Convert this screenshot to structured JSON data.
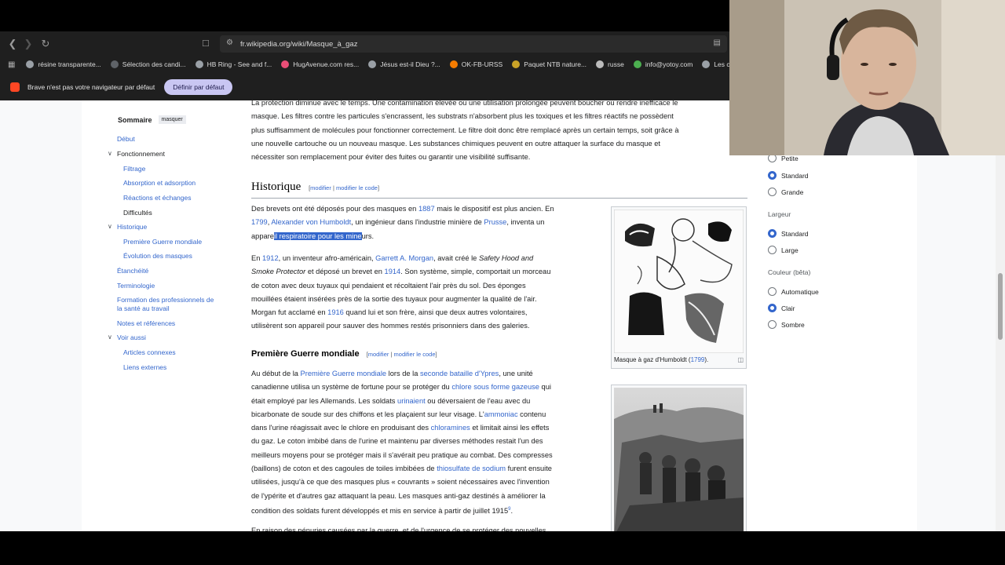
{
  "browser": {
    "url": "fr.wikipedia.org/wiki/Masque_à_gaz",
    "bookmarks": [
      {
        "label": "résine transparente...",
        "color": "#9aa0a6"
      },
      {
        "label": "Sélection des candi...",
        "color": "#5f6368"
      },
      {
        "label": "HB Ring - See and f...",
        "color": "#9aa0a6"
      },
      {
        "label": "HugAvenue.com res...",
        "color": "#e94e77"
      },
      {
        "label": "Jésus est-il Dieu ?...",
        "color": "#9aa0a6"
      },
      {
        "label": "OK-FB-URSS",
        "color": "#f57c00"
      },
      {
        "label": "Paquet NTB nature...",
        "color": "#c9a227"
      },
      {
        "label": "russe",
        "color": "#bbbbbb"
      },
      {
        "label": "info@yotoy.com",
        "color": "#4caf50"
      },
      {
        "label": "Les concours d'a",
        "color": "#9aa0a6"
      }
    ],
    "infobar": {
      "text": "Brave n'est pas votre navigateur par défaut",
      "button": "Définir par défaut"
    },
    "nav_icons": [
      "back-icon",
      "forward-icon",
      "reload-icon"
    ]
  },
  "toc": {
    "title": "Sommaire",
    "hide": "masquer",
    "items": [
      {
        "label": "Début"
      },
      {
        "label": "Fonctionnement"
      },
      {
        "label": "Filtrage"
      },
      {
        "label": "Absorption et adsorption"
      },
      {
        "label": "Réactions et échanges"
      },
      {
        "label": "Difficultés"
      },
      {
        "label": "Historique"
      },
      {
        "label": "Première Guerre mondiale"
      },
      {
        "label": "Évolution des masques"
      },
      {
        "label": "Étanchéité"
      },
      {
        "label": "Terminologie"
      },
      {
        "label": "Formation des professionnels de"
      },
      {
        "label": "la santé au travail"
      },
      {
        "label": "Notes et références"
      },
      {
        "label": "Voir aussi"
      },
      {
        "label": "Articles connexes"
      },
      {
        "label": "Liens externes"
      }
    ]
  },
  "article": {
    "intro_lines": [
      "La protection diminue avec le temps. Une contamination élevée ou une utilisation prolongée peuvent boucher ou rendre inefficace le",
      "masque. Les filtres contre les particules s'encrassent, les substrats n'absorbent plus les toxiques et les filtres réactifs ne possèdent",
      "plus suffisamment de molécules pour fonctionner correctement. Le filtre doit donc être remplacé après un certain temps, soit grâce à",
      "une nouvelle cartouche ou un nouveau masque. Les substances chimiques peuvent en outre attaquer la surface du masque et",
      "nécessiter son remplacement pour éviter des fuites ou garantir une visibilité suffisante."
    ],
    "historique": {
      "title": "Historique",
      "edit": "modifier",
      "edit_code": "modifier le code",
      "sep": "|",
      "open": "[",
      "close": "]",
      "p1": {
        "l1a": "Des brevets ont été déposés pour des masques en ",
        "l1link": "1887",
        "l1b": " mais le dispositif est plus ancien. En",
        "l2link1": "1799",
        "l2a": ", ",
        "l2link2": "Alexander von Humboldt",
        "l2b": ", un ingénieur dans l'industrie minière de ",
        "l2link3": "Prusse",
        "l2c": ", inventa un",
        "l3a": "appare",
        "l3sel": "il respiratoire pour les mine",
        "l3b": "urs."
      },
      "p2": {
        "l1a": "En ",
        "l1link1": "1912",
        "l1b": ", un inventeur afro-américain, ",
        "l1link2": "Garrett A. Morgan",
        "l1c": ", avait créé le ",
        "l1i": "Safety Hood and",
        "l2i": "Smoke Protector",
        "l2a": " et déposé un brevet en ",
        "l2link": "1914",
        "l2b": ". Son système, simple, comportait un morceau",
        "l3": "de coton avec deux tuyaux qui pendaient et récoltaient l'air près du sol. Des éponges",
        "l4": "mouillées étaient insérées près de la sortie des tuyaux pour augmenter la qualité de l'air.",
        "l5a": "Morgan fut acclamé en ",
        "l5link": "1916",
        "l5b": " quand lui et son frère, ainsi que deux autres volontaires,",
        "l6": "utilisèrent son appareil pour sauver des hommes restés prisonniers dans des galeries."
      },
      "figure1_caption_a": "Masque à gaz d'Humboldt (",
      "figure1_caption_link": "1799",
      "figure1_caption_b": ")."
    },
    "pgm": {
      "title": "Première Guerre mondiale",
      "l1a": "Au début de la ",
      "l1link1": "Première Guerre mondiale",
      "l1b": " lors de la ",
      "l1link2": "seconde bataille d'Ypres",
      "l1c": ", une unité",
      "l2a": "canadienne utilisa un système de fortune pour se protéger du ",
      "l2link": "chlore sous forme gazeuse",
      "l2b": " qui",
      "l3a": "était employé par les Allemands. Les soldats ",
      "l3link": "urinaient",
      "l3b": " ou déversaient de l'eau avec du",
      "l4a": "bicarbonate de soude sur des chiffons et les plaçaient sur leur visage. L'",
      "l4link": "ammoniac",
      "l4b": " contenu",
      "l5a": "dans l'urine réagissait avec le chlore en produisant des ",
      "l5link": "chloramines",
      "l5b": " et limitait ainsi les effets",
      "l6": "du gaz. Le coton imbibé dans de l'urine et maintenu par diverses méthodes restait l'un des",
      "l7": "meilleurs moyens pour se protéger mais il s'avérait peu pratique au combat. Des compresses",
      "l8a": "(baillons) de coton et des cagoules de toiles imbibées de ",
      "l8link": "thiosulfate de sodium",
      "l8b": " furent ensuite",
      "l9": "utilisées, jusqu'à ce que des masques plus « couvrants » soient nécessaires avec l'invention",
      "l10": "de l'ypérite et d'autres gaz attaquant la peau. Les masques anti-gaz destinés à améliorer la",
      "l11a": "condition des soldats furent développés et mis en service à partir de juillet 1915",
      "l11sup": "9",
      "l11b": ".",
      "l12": "En raison des pénuries causées par la guerre, et de l'urgence de se protéger des nouvelles"
    }
  },
  "panel": {
    "size_options": [
      {
        "label": "Petite",
        "selected": false
      },
      {
        "label": "Standard",
        "selected": true
      },
      {
        "label": "Grande",
        "selected": false
      }
    ],
    "width_label": "Largeur",
    "width_options": [
      {
        "label": "Standard",
        "selected": true
      },
      {
        "label": "Large",
        "selected": false
      }
    ],
    "color_label": "Couleur (bêta)",
    "color_options": [
      {
        "label": "Automatique",
        "selected": false
      },
      {
        "label": "Clair",
        "selected": true
      },
      {
        "label": "Sombre",
        "selected": false
      }
    ]
  },
  "colors": {
    "link": "#3366cc",
    "selection": "#3366cc",
    "chrome": "#1f1f1f",
    "infobar_button": "#c9c6f2"
  }
}
